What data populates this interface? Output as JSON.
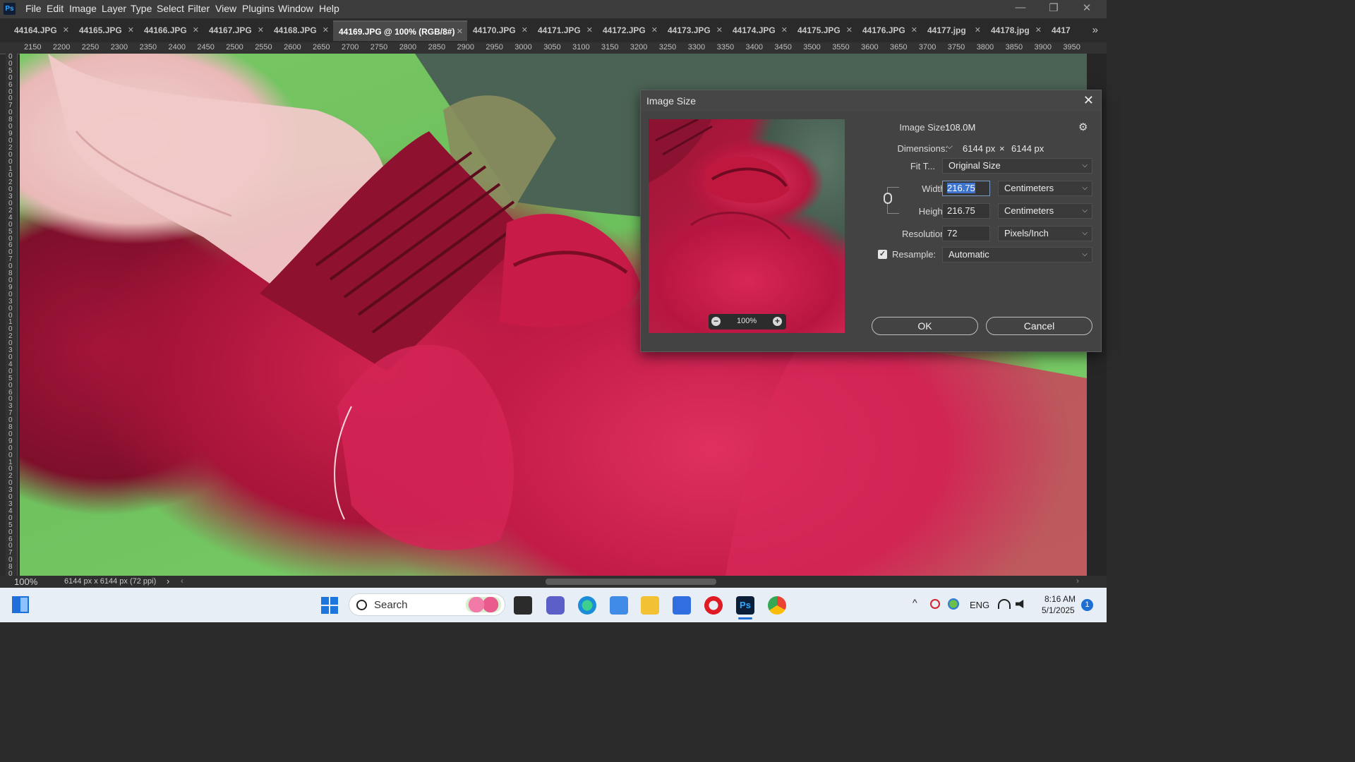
{
  "app": {
    "logo": "Ps"
  },
  "menu": [
    "File",
    "Edit",
    "Image",
    "Layer",
    "Type",
    "Select",
    "Filter",
    "View",
    "Plugins",
    "Window",
    "Help"
  ],
  "window_controls": {
    "minimize": "—",
    "maximize": "❐",
    "close": "✕"
  },
  "tabs": [
    {
      "label": "44164.JPG",
      "active": false
    },
    {
      "label": "44165.JPG",
      "active": false
    },
    {
      "label": "44166.JPG",
      "active": false
    },
    {
      "label": "44167.JPG",
      "active": false
    },
    {
      "label": "44168.JPG",
      "active": false
    },
    {
      "label": "44169.JPG @ 100% (RGB/8#)",
      "active": true
    },
    {
      "label": "44170.JPG",
      "active": false
    },
    {
      "label": "44171.JPG",
      "active": false
    },
    {
      "label": "44172.JPG",
      "active": false
    },
    {
      "label": "44173.JPG",
      "active": false
    },
    {
      "label": "44174.JPG",
      "active": false
    },
    {
      "label": "44175.JPG",
      "active": false
    },
    {
      "label": "44176.JPG",
      "active": false
    },
    {
      "label": "44177.jpg",
      "active": false
    },
    {
      "label": "44178.jpg",
      "active": false
    },
    {
      "label": "4417",
      "active": false
    }
  ],
  "tab_close_glyph": "✕",
  "tab_more_glyph": "»",
  "ruler": {
    "h_ticks": [
      "2150",
      "2200",
      "2250",
      "2300",
      "2350",
      "2400",
      "2450",
      "2500",
      "2550",
      "2600",
      "2650",
      "2700",
      "2750",
      "2800",
      "2850",
      "2900",
      "2950",
      "3000",
      "3050",
      "3100",
      "3150",
      "3200",
      "3250",
      "3300",
      "3350",
      "3400",
      "3450",
      "3500",
      "3550",
      "3600",
      "3650",
      "3700",
      "3750",
      "3800",
      "3850",
      "3900",
      "3950"
    ],
    "v_digits": "0 0 5 0 6 0 0 7 0 8 0 9 0 2 0 0 1 0 2 0 3 0 2 4 0 5 0 6 0 7 0 8 0 9 0 3 0 0 1 0 2 0 3 0 4 0 5 0 6 0 3 7 0 8 0 9 0 0 1 0 2 0 3 0 3 4 0 5 0 6 0 7 0 8 0 9"
  },
  "status": {
    "zoom": "100%",
    "doc_info": "6144 px x 6144 px (72 ppi)",
    "arrow": "›",
    "left_arrow": "‹",
    "right_arrow": "›"
  },
  "dialog": {
    "title": "Image Size",
    "close": "✕",
    "image_size_label": "Image Size:",
    "image_size_value": "108.0M",
    "gear_glyph": "⚙",
    "dimensions_label": "Dimensions:",
    "dimensions_chevron": "⌵",
    "dim_w": "6144 px",
    "dim_x": "×",
    "dim_h": "6144 px",
    "fit_label": "Fit T...",
    "fit_value": "Original Size",
    "width_label": "Width:",
    "width_value": "216.75",
    "width_unit": "Centimeters",
    "height_label": "Height:",
    "height_value": "216.75",
    "height_unit": "Centimeters",
    "resolution_label": "Resolution:",
    "resolution_value": "72",
    "resolution_unit": "Pixels/Inch",
    "resample_label": "Resample:",
    "resample_checked": true,
    "resample_value": "Automatic",
    "chevron": "⌵",
    "link_glyph": "🔗",
    "preview_zoom": "100%",
    "zoom_out": "−",
    "zoom_in": "+",
    "ok_label": "OK",
    "cancel_label": "Cancel"
  },
  "taskbar": {
    "search_label": "Search",
    "tray_language": "ENG",
    "time": "8:16 AM",
    "date": "5/1/2025",
    "notification_count": "1",
    "up_arrow": "^"
  }
}
